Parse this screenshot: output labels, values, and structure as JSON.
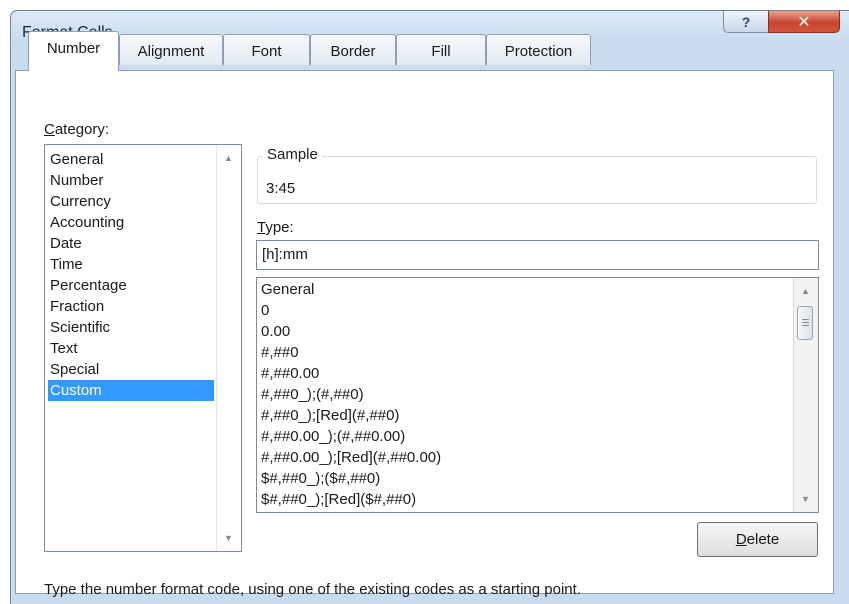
{
  "window": {
    "title": "Format Cells"
  },
  "tabs": [
    {
      "label": "Number",
      "active": true
    },
    {
      "label": "Alignment",
      "active": false
    },
    {
      "label": "Font",
      "active": false
    },
    {
      "label": "Border",
      "active": false
    },
    {
      "label": "Fill",
      "active": false
    },
    {
      "label": "Protection",
      "active": false
    }
  ],
  "category": {
    "label_accel": "C",
    "label_rest": "ategory:",
    "items": [
      "General",
      "Number",
      "Currency",
      "Accounting",
      "Date",
      "Time",
      "Percentage",
      "Fraction",
      "Scientific",
      "Text",
      "Special",
      "Custom"
    ],
    "selected": "Custom"
  },
  "sample": {
    "label": "Sample",
    "value": "3:45"
  },
  "type": {
    "label_accel": "T",
    "label_rest": "ype:",
    "value": "[h]:mm",
    "list": [
      "General",
      "0",
      "0.00",
      "#,##0",
      "#,##0.00",
      "#,##0_);(#,##0)",
      "#,##0_);[Red](#,##0)",
      "#,##0.00_);(#,##0.00)",
      "#,##0.00_);[Red](#,##0.00)",
      "$#,##0_);($#,##0)",
      "$#,##0_);[Red]($#,##0)"
    ]
  },
  "buttons": {
    "delete_accel": "D",
    "delete_rest": "elete"
  },
  "hint": "Type the number format code, using one of the existing codes as a starting point.",
  "colors": {
    "selection": "#3399ff",
    "close_button": "#c8452c",
    "frame": "#c9dcef"
  },
  "icons": {
    "help": "question-icon",
    "close": "close-icon"
  }
}
